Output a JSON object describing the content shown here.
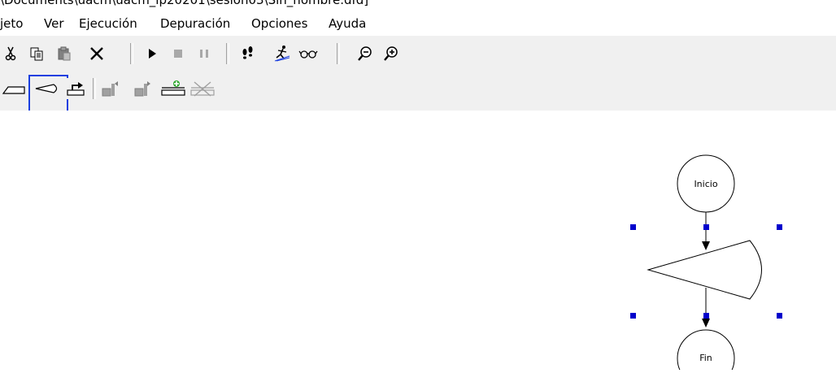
{
  "window": {
    "title": "\\Documents\\uacm\\uacm_ip20201\\sesion03\\Sin_nombre.dfd]"
  },
  "menu": {
    "items": [
      {
        "label": "jeto"
      },
      {
        "label": "Ver"
      },
      {
        "label": "Ejecución"
      },
      {
        "label": "Depuración"
      },
      {
        "label": "Opciones"
      },
      {
        "label": "Ayuda"
      }
    ]
  },
  "toolbar": {
    "row1": [
      {
        "icon": "scissors-icon",
        "name": "cut"
      },
      {
        "icon": "copy-icon",
        "name": "copy"
      },
      {
        "icon": "paste-icon",
        "name": "paste"
      },
      {
        "icon": "delete-x-icon",
        "name": "delete"
      },
      {
        "icon": "play-icon",
        "name": "run"
      },
      {
        "icon": "stop-icon",
        "name": "stop"
      },
      {
        "icon": "pause-icon",
        "name": "pause"
      },
      {
        "icon": "footsteps-icon",
        "name": "step"
      },
      {
        "icon": "runner-icon",
        "name": "run-to-cursor"
      },
      {
        "icon": "glasses-icon",
        "name": "watch"
      },
      {
        "icon": "zoom-out-icon",
        "name": "zoom-out"
      },
      {
        "icon": "zoom-in-icon",
        "name": "zoom-in"
      }
    ],
    "row2": [
      {
        "icon": "read-shape-icon",
        "name": "read"
      },
      {
        "icon": "decision-shape-icon",
        "name": "decision",
        "selected": true
      },
      {
        "icon": "output-shape-icon",
        "name": "output"
      },
      {
        "icon": "subprogram-left-icon",
        "name": "subprogram-left"
      },
      {
        "icon": "subprogram-right-icon",
        "name": "subprogram-right"
      },
      {
        "icon": "add-subprogram-icon",
        "name": "add-subprogram"
      },
      {
        "icon": "remove-subprogram-icon",
        "name": "remove-subprogram"
      }
    ]
  },
  "diagram": {
    "start_label": "Inicio",
    "end_label": "Fin",
    "selection_color": "#0000cc"
  }
}
